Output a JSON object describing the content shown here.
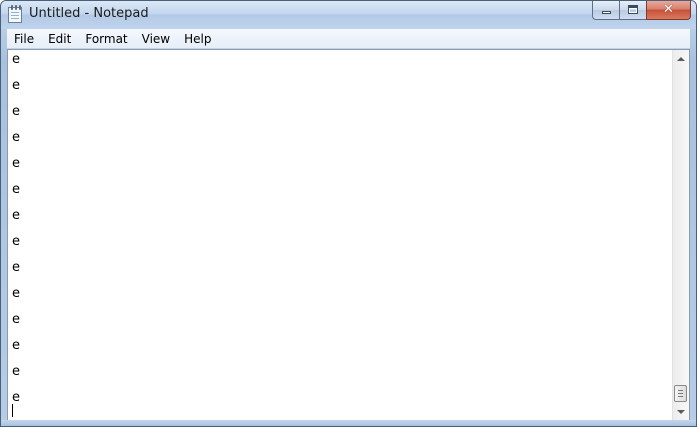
{
  "window": {
    "title": "Untitled - Notepad",
    "app_icon": "notepad-icon"
  },
  "caption_buttons": {
    "minimize_icon": "minimize-icon",
    "maximize_icon": "maximize-icon",
    "close_icon": "close-icon",
    "close_glyph": "✕"
  },
  "menubar": {
    "items": [
      {
        "label": "File"
      },
      {
        "label": "Edit"
      },
      {
        "label": "Format"
      },
      {
        "label": "View"
      },
      {
        "label": "Help"
      }
    ]
  },
  "editor": {
    "lines": [
      "e",
      "e",
      "e",
      "e",
      "e",
      "e",
      "e",
      "e",
      "e",
      "e",
      "e",
      "e",
      "e",
      "e",
      ""
    ]
  },
  "scrollbar": {
    "up_icon": "scroll-up-arrow-icon",
    "down_icon": "scroll-down-arrow-icon"
  },
  "colors": {
    "titlebar": "#c3d7ee",
    "close_button": "#c8503a",
    "editor_background": "#ffffff"
  }
}
